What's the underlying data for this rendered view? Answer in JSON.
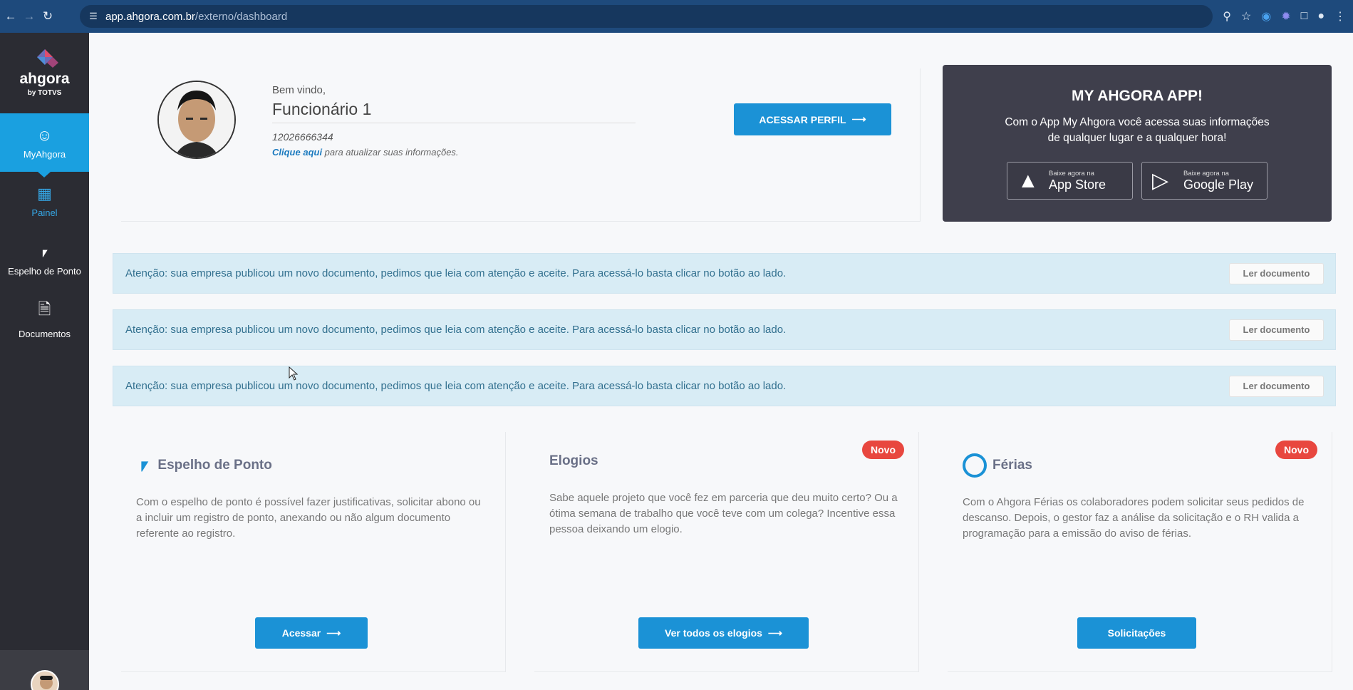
{
  "browser": {
    "url_host": "app.ahgora.com.br",
    "url_path": "/externo/dashboard"
  },
  "sidebar": {
    "logo_text": "ahgora",
    "logo_sub": "by TOTVS",
    "items": [
      {
        "label": "MyAhgora",
        "icon": "user-circle-icon"
      },
      {
        "label": "Painel",
        "icon": "dashboard-grid-icon"
      },
      {
        "label": "Espelho de Ponto",
        "icon": "monitor-star-icon"
      },
      {
        "label": "Documentos",
        "icon": "document-icon"
      }
    ]
  },
  "profile": {
    "welcome": "Bem vindo,",
    "name": "Funcionário 1",
    "id": "12026666344",
    "update_link": "Clique aqui",
    "update_rest": " para atualizar suas informações.",
    "button_label": "ACESSAR PERFIL"
  },
  "app_promo": {
    "title": "MY AHGORA APP!",
    "description": "Com o App My Ahgora você acessa suas informações de qualquer lugar e a qualquer hora!",
    "app_store_small": "Baixe agora na",
    "app_store_big": "App Store",
    "google_play_small": "Baixe agora na",
    "google_play_big": "Google Play"
  },
  "notices": [
    {
      "text": "Atenção: sua empresa publicou um novo documento, pedimos que leia com atenção e aceite. Para acessá-lo basta clicar no botão ao lado.",
      "button": "Ler documento"
    },
    {
      "text": "Atenção: sua empresa publicou um novo documento, pedimos que leia com atenção e aceite. Para acessá-lo basta clicar no botão ao lado.",
      "button": "Ler documento"
    },
    {
      "text": "Atenção: sua empresa publicou um novo documento, pedimos que leia com atenção e aceite. Para acessá-lo basta clicar no botão ao lado.",
      "button": "Ler documento"
    }
  ],
  "features": [
    {
      "title": "Espelho de Ponto",
      "badge": "",
      "description": "Com o espelho de ponto é possível fazer justificativas, solicitar abono ou a incluir um registro de ponto, anexando ou não algum documento referente ao registro.",
      "button": "Acessar"
    },
    {
      "title": "Elogios",
      "badge": "Novo",
      "description": "Sabe aquele projeto que você fez em parceria que deu muito certo? Ou a ótima semana de trabalho que você teve com um colega? Incentive essa pessoa deixando um elogio.",
      "button": "Ver todos os elogios"
    },
    {
      "title": "Férias",
      "badge": "Novo",
      "description": "Com o Ahgora Férias os colaboradores podem solicitar seus pedidos de descanso. Depois, o gestor faz a análise da solicitação e o RH valida a programação para a emissão do aviso de férias.",
      "button": "Solicitações"
    }
  ],
  "colors": {
    "accent": "#1b92d6",
    "sidebar": "#2b2c33",
    "badge": "#e8473f"
  }
}
